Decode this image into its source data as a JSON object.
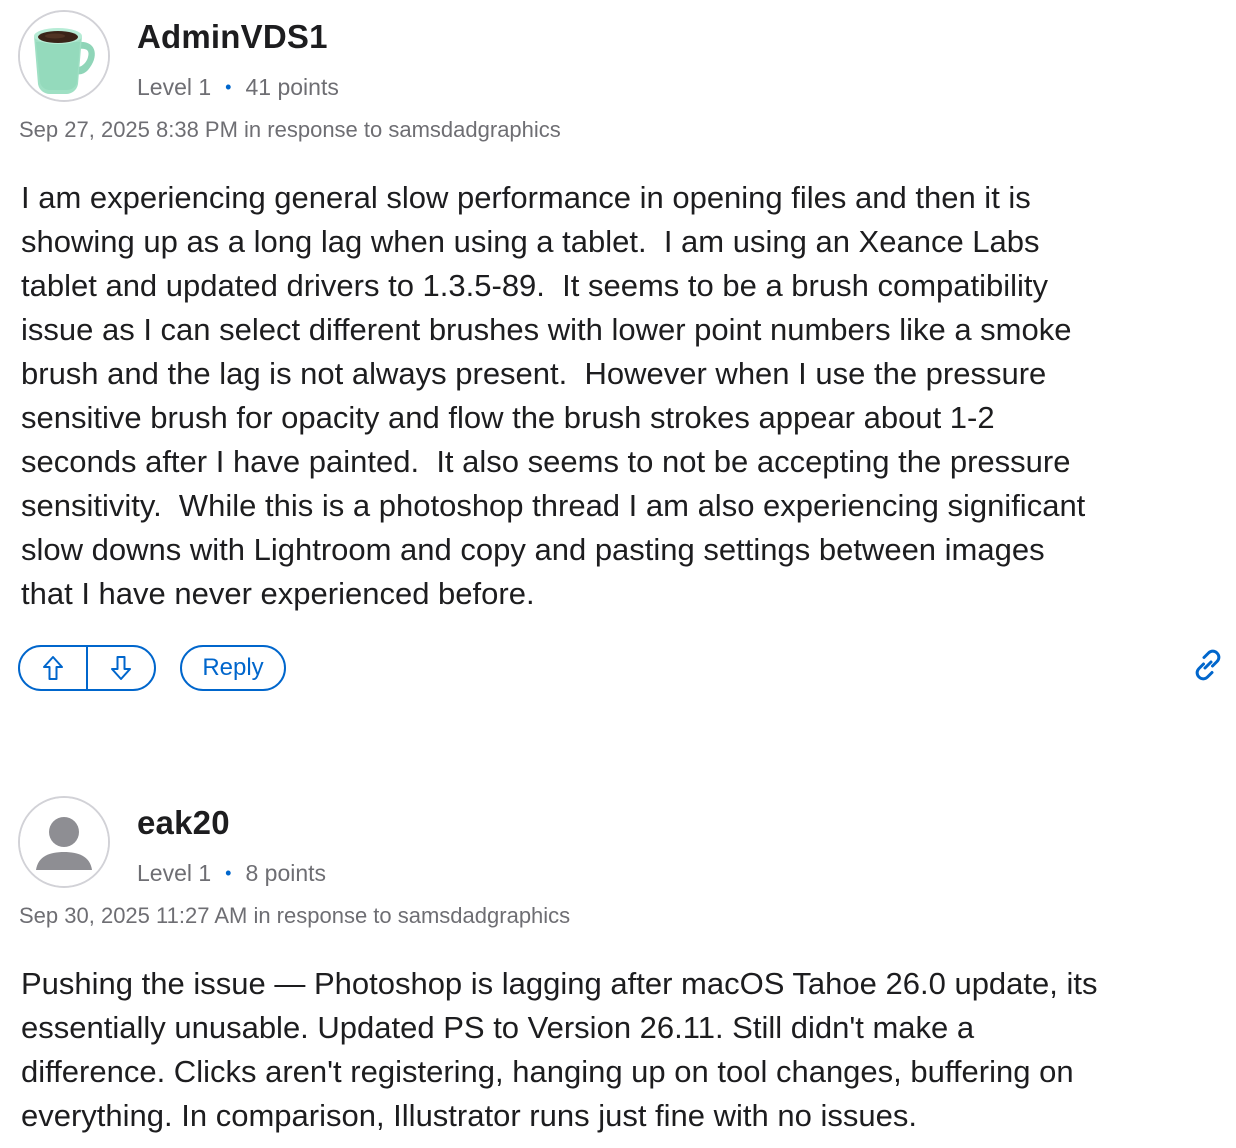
{
  "posts": [
    {
      "username": "AdminVDS1",
      "level": "Level 1",
      "points": "41 points",
      "timestamp": "Sep 27, 2025 8:38 PM in response to samsdadgraphics",
      "avatar_icon": "coffee-mug-icon",
      "body": "I am experiencing general slow performance in opening files and then it is\nshowing up as a long lag when using a tablet.  I am using an Xeance Labs\ntablet and updated drivers to 1.3.5-89.  It seems to be a brush compatibility\nissue as I can select different brushes with lower point numbers like a smoke\nbrush and the lag is not always present.  However when I use the pressure\nsensitive brush for opacity and flow the brush strokes appear about 1-2\nseconds after I have painted.  It also seems to not be accepting the pressure\nsensitivity.  While this is a photoshop thread I am also experiencing significant\nslow downs with Lightroom and copy and pasting settings between images\nthat I have never experienced before.",
      "actions": {
        "upvote_icon": "arrow-up-icon",
        "downvote_icon": "arrow-down-icon",
        "reply_label": "Reply",
        "link_icon": "link-icon"
      }
    },
    {
      "username": "eak20",
      "level": "Level 1",
      "points": "8 points",
      "timestamp": "Sep 30, 2025 11:27 AM in response to samsdadgraphics",
      "avatar_icon": "default-user-icon",
      "body": "Pushing the issue — Photoshop is lagging after macOS Tahoe 26.0 update, its\nessentially unusable. Updated PS to Version 26.11. Still didn't make a\ndifference. Clicks aren't registering, hanging up on tool changes, buffering on\neverything. In comparison, Illustrator runs just fine with no issues."
    }
  ],
  "meta_separator": "•",
  "colors": {
    "accent": "#0066cc",
    "text": "#1d1d1f",
    "secondary_text": "#6e6e73",
    "avatar_border": "#d2d2d7"
  }
}
